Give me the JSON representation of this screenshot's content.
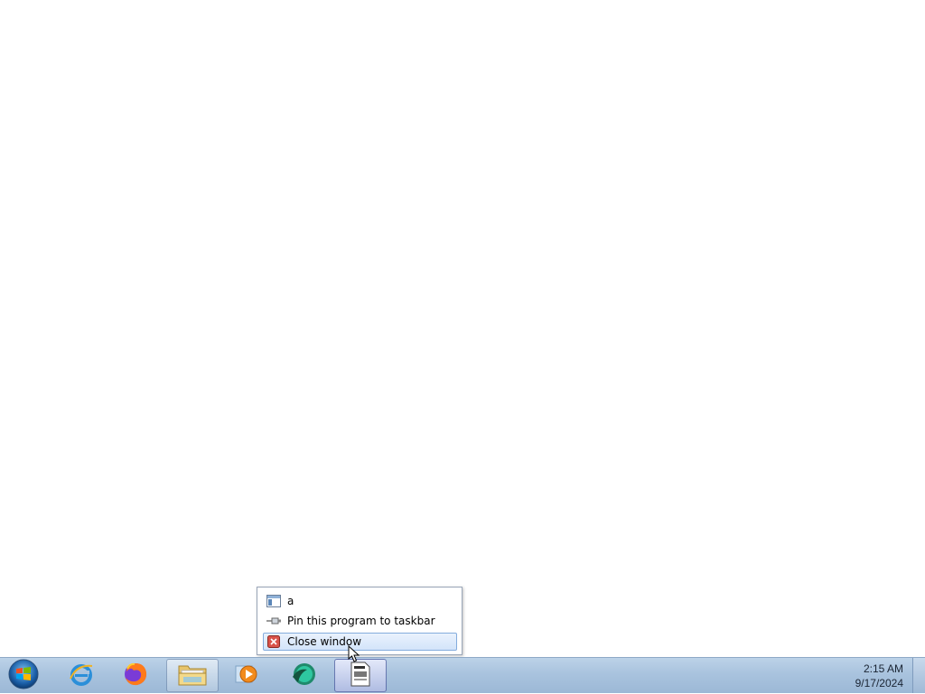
{
  "jumplist": {
    "items": [
      {
        "label": "a",
        "icon": "window-icon"
      },
      {
        "label": "Pin this program to taskbar",
        "icon": "pin-icon"
      },
      {
        "label": "Close window",
        "icon": "close-window-icon",
        "highlighted": true
      }
    ]
  },
  "taskbar": {
    "start_icon": "windows-orb-icon",
    "buttons": [
      {
        "name": "internet-explorer",
        "icon": "internet-explorer-icon"
      },
      {
        "name": "firefox",
        "icon": "firefox-icon"
      },
      {
        "name": "file-explorer",
        "icon": "folder-icon",
        "active": true
      },
      {
        "name": "media-player",
        "icon": "media-player-icon"
      },
      {
        "name": "app-green",
        "icon": "green-app-icon"
      },
      {
        "name": "document-app",
        "icon": "document-icon",
        "active": true
      }
    ],
    "clock": {
      "time": "2:15 AM",
      "date": "9/17/2024"
    }
  },
  "colors": {
    "taskbar": "#a9c3de",
    "highlight": "#d3e4fa"
  }
}
